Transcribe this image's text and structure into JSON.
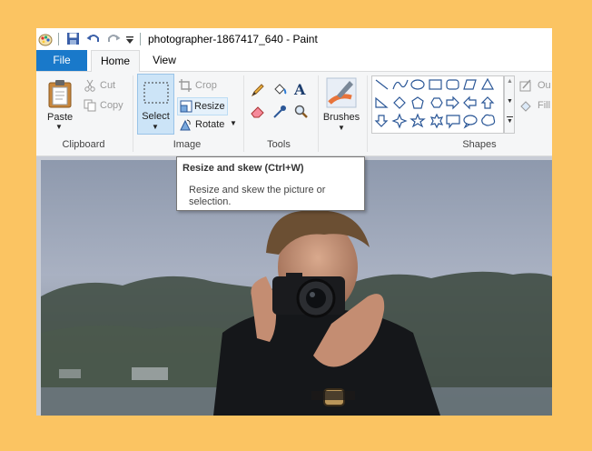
{
  "window": {
    "title": "photographer-1867417_640 - Paint"
  },
  "quick_access": {
    "save_icon": "floppy-disk-icon",
    "undo_icon": "undo-icon",
    "redo_icon": "redo-icon",
    "customize_icon": "dropdown-arrow-icon"
  },
  "tabs": {
    "file": "File",
    "home": "Home",
    "view": "View"
  },
  "ribbon": {
    "clipboard": {
      "label": "Clipboard",
      "paste": "Paste",
      "cut": "Cut",
      "copy": "Copy"
    },
    "image": {
      "label": "Image",
      "select": "Select",
      "crop": "Crop",
      "resize": "Resize",
      "rotate": "Rotate"
    },
    "tools": {
      "label": "Tools"
    },
    "brushes": {
      "label": "Brushes"
    },
    "shapes": {
      "label": "Shapes",
      "outline": "Ou",
      "fill": "Fill"
    }
  },
  "tooltip": {
    "title": "Resize and skew (Ctrl+W)",
    "description": "Resize and skew the picture or selection."
  },
  "colors": {
    "accent": "#1979ca",
    "background": "#fbc462",
    "selected": "#cce4f7"
  }
}
